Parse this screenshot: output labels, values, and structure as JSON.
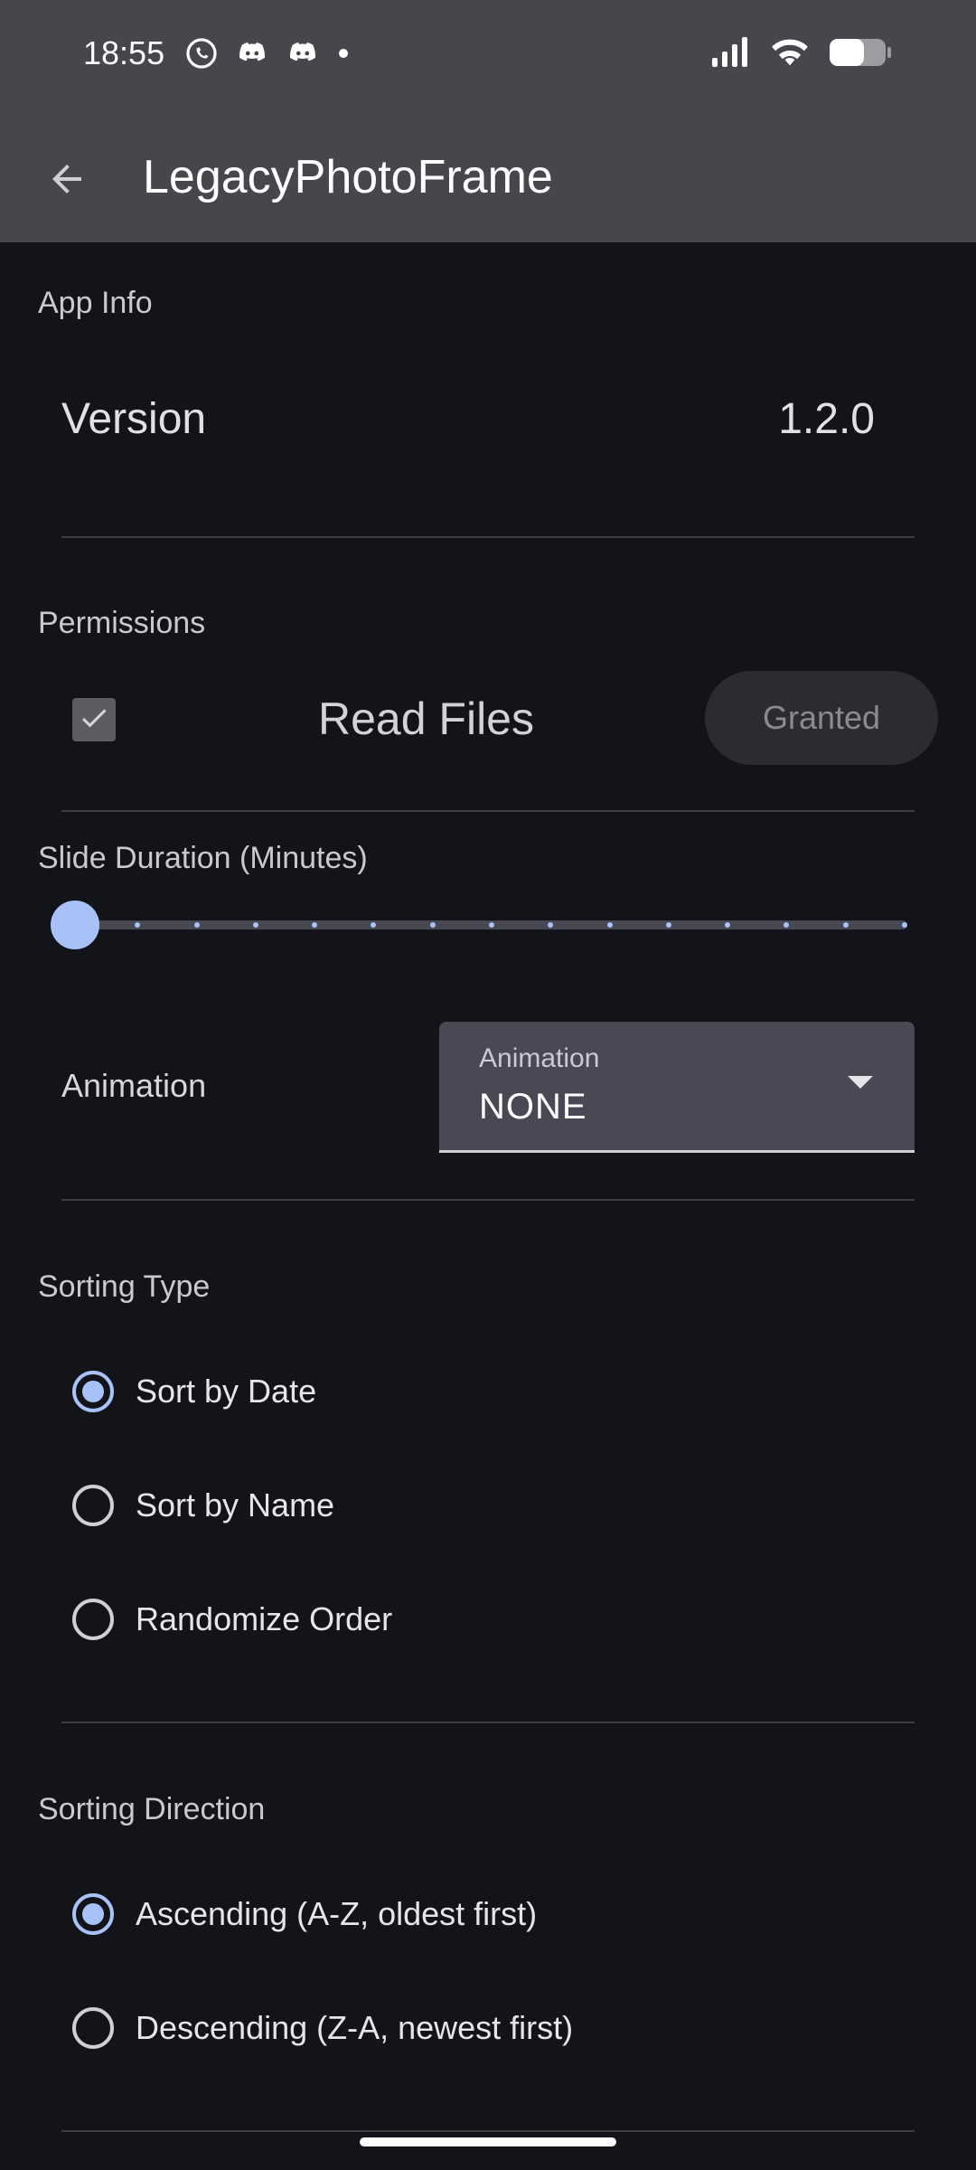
{
  "status_bar": {
    "time": "18:55",
    "icons_left": [
      "whatsapp-icon",
      "discord-icon",
      "discord-icon",
      "dot-icon"
    ],
    "icons_right": [
      "signal-icon",
      "wifi-icon",
      "battery-icon"
    ]
  },
  "app_bar": {
    "title": "LegacyPhotoFrame",
    "back_icon": "arrow-back-icon"
  },
  "app_info": {
    "section": "App Info",
    "version_label": "Version",
    "version_value": "1.2.0"
  },
  "permissions": {
    "section": "Permissions",
    "read_files_label": "Read Files",
    "granted_label": "Granted",
    "checked": true
  },
  "slide_duration": {
    "section": "Slide Duration (Minutes)",
    "value_fraction": 0.0
  },
  "animation": {
    "label": "Animation",
    "dropdown_caption": "Animation",
    "selected": "NONE"
  },
  "sorting_type": {
    "section": "Sorting Type",
    "options": [
      "Sort by Date",
      "Sort by Name",
      "Randomize Order"
    ],
    "selected_index": 0
  },
  "sorting_direction": {
    "section": "Sorting Direction",
    "options": [
      "Ascending (A-Z, oldest first)",
      "Descending (Z-A, newest first)"
    ],
    "selected_index": 0
  },
  "colors": {
    "background": "#131419",
    "app_bar": "#45474c",
    "accent": "#a8c2f7",
    "dropdown_bg": "#4b4856"
  }
}
